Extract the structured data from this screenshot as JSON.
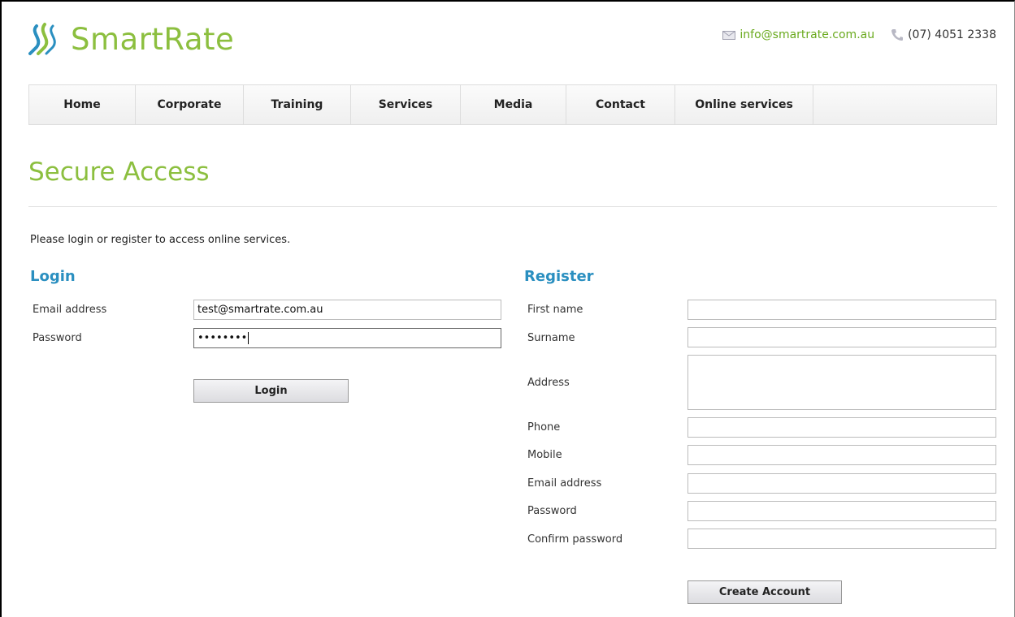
{
  "header": {
    "logo_text": "SmartRate",
    "email": "info@smartrate.com.au",
    "phone": "(07) 4051 2338",
    "brand_color": "#8cbf3f",
    "icons": {
      "email": "envelope-icon",
      "phone": "phone-icon",
      "logo": "smartrate-logo-icon"
    }
  },
  "nav": {
    "items": [
      {
        "label": "Home"
      },
      {
        "label": "Corporate"
      },
      {
        "label": "Training"
      },
      {
        "label": "Services"
      },
      {
        "label": "Media"
      },
      {
        "label": "Contact"
      },
      {
        "label": "Online services"
      }
    ]
  },
  "page": {
    "title": "Secure Access",
    "intro": "Please login or register to access online services."
  },
  "login": {
    "title": "Login",
    "email_label": "Email address",
    "email_value": "test@smartrate.com.au",
    "password_label": "Password",
    "password_value": "••••••••",
    "button_label": "Login"
  },
  "register": {
    "title": "Register",
    "first_name_label": "First name",
    "surname_label": "Surname",
    "address_label": "Address",
    "phone_label": "Phone",
    "mobile_label": "Mobile",
    "email_label": "Email address",
    "password_label": "Password",
    "confirm_password_label": "Confirm password",
    "button_label": "Create Account"
  },
  "colors": {
    "accent_green": "#8cbf3f",
    "heading_blue": "#2a8fc0"
  }
}
